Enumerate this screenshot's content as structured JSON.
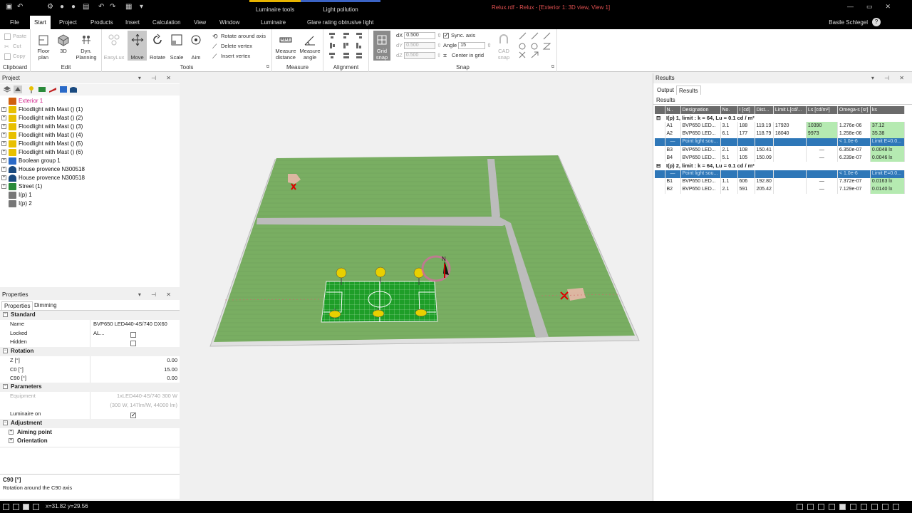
{
  "titlebar": {
    "window_title": "Relux.rdf - Relux - [Exterior 1: 3D view, View 1]",
    "context_tabs": [
      "Luminaire tools",
      "Light pollution"
    ],
    "colors": {
      "luminaire_tools": "#e8b400",
      "light_pollution": "#3b63c4",
      "title": "#e05050"
    }
  },
  "menubar": {
    "tabs": [
      "File",
      "Start",
      "Project",
      "Products",
      "Insert",
      "Calculation",
      "View",
      "Window",
      "Luminaire",
      "Glare rating obtrusive light"
    ],
    "active": "Start",
    "user": "Basile Schlegel",
    "help": "?"
  },
  "ribbon": {
    "clipboard": {
      "label": "Clipboard",
      "paste": "Paste",
      "cut": "Cut",
      "copy": "Copy"
    },
    "edit": {
      "label": "Edit",
      "floor_plan_1": "Floor",
      "floor_plan_2": "plan",
      "three_d": "3D",
      "dyn_1": "Dyn.",
      "dyn_2": "Planning"
    },
    "tools": {
      "label": "Tools",
      "easylux": "EasyLux",
      "move": "Move",
      "rotate": "Rotate",
      "scale": "Scale",
      "aim": "Aim",
      "rotate_axis": "Rotate around axis",
      "delete_vertex": "Delete vertex",
      "insert_vertex": "Insert vertex"
    },
    "measure": {
      "label": "Measure",
      "distance_1": "Measure",
      "distance_2": "distance",
      "angle_1": "Measure",
      "angle_2": "angle"
    },
    "alignment": {
      "label": "Alignment"
    },
    "snap": {
      "label": "Snap",
      "grid_1": "Grid",
      "grid_2": "snap",
      "dx_label": "dX",
      "dx": "0.500",
      "dy_label": "dY",
      "dy": "0.500",
      "dz_label": "dZ",
      "dz": "0.500",
      "sync": "Sync. axis",
      "angle_label": "Angle",
      "angle": "15",
      "center": "Center in grid",
      "cad_1": "CAD",
      "cad_2": "snap"
    }
  },
  "project": {
    "title": "Project",
    "items": [
      {
        "label": "Exterior 1",
        "selected": true,
        "expander": false
      },
      {
        "label": "Floodlight with Mast () (1)",
        "expander": true
      },
      {
        "label": "Floodlight with Mast () (2)",
        "expander": true
      },
      {
        "label": "Floodlight with Mast () (3)",
        "expander": true
      },
      {
        "label": "Floodlight with Mast () (4)",
        "expander": true
      },
      {
        "label": "Floodlight with Mast () (5)",
        "expander": true
      },
      {
        "label": "Floodlight with Mast () (6)",
        "expander": true
      },
      {
        "label": "Boolean group 1",
        "expander": true
      },
      {
        "label": "House provence N300518",
        "expander": true
      },
      {
        "label": "House provence N300518",
        "expander": true
      },
      {
        "label": "Street (1)",
        "expander": true
      },
      {
        "label": "I(p) 1",
        "expander": false
      },
      {
        "label": "I(p) 2",
        "expander": false
      }
    ]
  },
  "properties": {
    "title": "Properties",
    "tabs": [
      "Properties",
      "Dimming"
    ],
    "standard": "Standard",
    "name_label": "Name",
    "name_value": "BVP650 LED440-4S/740 DX60 AL...",
    "locked_label": "Locked",
    "hidden_label": "Hidden",
    "rotation": "Rotation",
    "z_label": "Z [°]",
    "z_value": "0.00",
    "c0_label": "C0 [°]",
    "c0_value": "15.00",
    "c90_label": "C90 [°]",
    "c90_value": "0.00",
    "parameters": "Parameters",
    "equipment_label": "Equipment",
    "equipment_value": "1xLED440-4S/740 300 W",
    "equipment_sub": "(300 W, 147lm/W, 44000 lm)",
    "luminaire_on_label": "Luminaire on",
    "adjustment": "Adjustment",
    "aiming_point": "Aiming point",
    "orientation": "Orientation",
    "desc_title": "C90 [°]",
    "desc_text": "Rotation around the C90 axis"
  },
  "results": {
    "title": "Results",
    "tabs": [
      "Output",
      "Results"
    ],
    "subtab": "Results",
    "columns": [
      "N..",
      "Designation",
      "No.",
      "I [cd]",
      "Dist...",
      "Limit L[cd/...",
      "Ls [cd/m²]",
      "Omega-s [sr]",
      "ks"
    ],
    "group1": "I(p) 1, limit : k = 64, Lu = 0.1 cd / m²",
    "group2": "I(p) 2, limit : k = 64, Lu = 0.1 cd / m²",
    "rows1": [
      [
        "A1",
        "BVP650 LED...",
        "3.1",
        "188",
        "119.19",
        "17920",
        "10390",
        "1.276e-06",
        "37.12"
      ],
      [
        "A2",
        "BVP650 LED...",
        "6.1",
        "177",
        "118.79",
        "18040",
        "9973",
        "1.258e-06",
        "35.38"
      ],
      [
        "—",
        "Point light sou...",
        "",
        "",
        "",
        "",
        "",
        "< 1.0e-6",
        "Limit E=0.0..."
      ],
      [
        "B3",
        "BVP650 LED...",
        "2.1",
        "108",
        "150.41",
        "",
        "—",
        "6.350e-07",
        "0.0048 lx"
      ],
      [
        "B4",
        "BVP650 LED...",
        "5.1",
        "105",
        "150.09",
        "",
        "—",
        "6.239e-07",
        "0.0046 lx"
      ]
    ],
    "rows2": [
      [
        "—",
        "Point light sou...",
        "",
        "",
        "",
        "",
        "",
        "< 1.0e-6",
        "Limit E=0.0..."
      ],
      [
        "B1",
        "BVP650 LED...",
        "1.1",
        "606",
        "192.80",
        "",
        "—",
        "7.372e-07",
        "0.0163 lx"
      ],
      [
        "B2",
        "BVP650 LED...",
        "2.1",
        "591",
        "205.42",
        "",
        "—",
        "7.129e-07",
        "0.0140 lx"
      ]
    ],
    "colors": {
      "highlight": "#2e77b8",
      "good": "#b5eab1"
    }
  },
  "scene": {
    "north_label": "N"
  },
  "status": {
    "coords": "x=31.82 y=29.56"
  }
}
